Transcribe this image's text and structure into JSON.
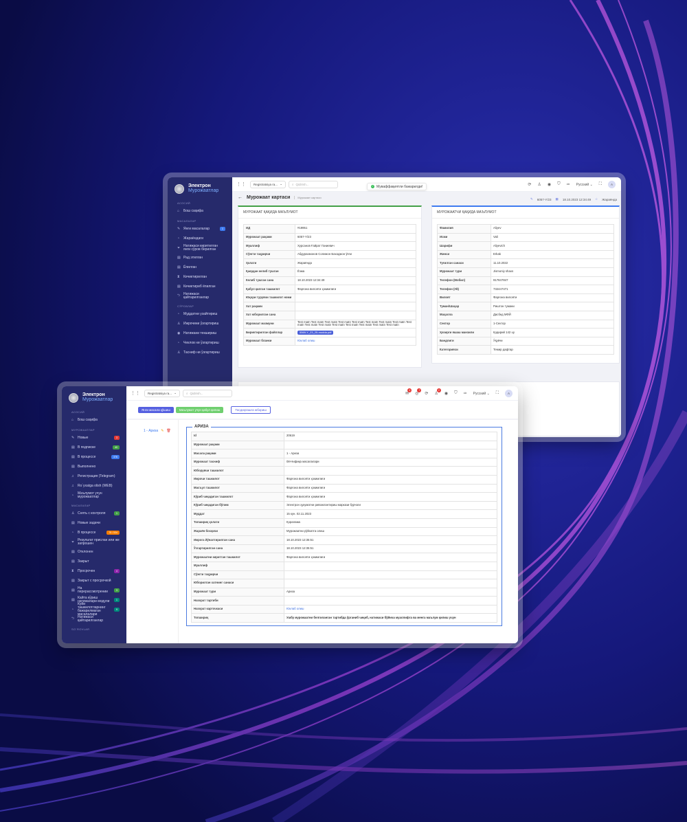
{
  "back": {
    "logo_line1": "Электрон",
    "logo_line2": "Мурожаатлар",
    "sections": [
      {
        "title": "Асосий",
        "items": [
          {
            "icon": "home-icon",
            "glyph": "⌂",
            "label": "Бош саҳифа"
          }
        ]
      },
      {
        "title": "Масалалар",
        "items": [
          {
            "icon": "edit-icon",
            "glyph": "✎",
            "label": "Янги масалалар",
            "badge": "1",
            "badge_color": "#3d7af0"
          },
          {
            "icon": "clock-icon",
            "glyph": "◔",
            "label": "Жараёндаги"
          },
          {
            "icon": "filter-icon",
            "glyph": "⏷",
            "label": "Натижаси киритилган янги сўров берилган"
          },
          {
            "icon": "doc-icon",
            "glyph": "▤",
            "label": "Рад этилган"
          },
          {
            "icon": "doc-icon",
            "glyph": "▤",
            "label": "Ёпилган"
          },
          {
            "icon": "hourglass-icon",
            "glyph": "⧗",
            "label": "Кечиктирилган"
          },
          {
            "icon": "doc-icon",
            "glyph": "▤",
            "label": "Кечиктириб ёпилган"
          },
          {
            "icon": "return-icon",
            "glyph": "⮌",
            "label": "Натижаси қайтарилганлар"
          }
        ]
      },
      {
        "title": "Сўровлар",
        "items": [
          {
            "icon": "clock-icon",
            "glyph": "◔",
            "label": "Муддатни узайтириш"
          },
          {
            "icon": "user-icon",
            "glyph": "♙",
            "label": "Ижрочини ўзгартириш"
          },
          {
            "icon": "eye-icon",
            "glyph": "◉",
            "label": "Натижани текшириш"
          },
          {
            "icon": "clock-icon",
            "glyph": "◔",
            "label": "Чеклов ни ўзгартириш"
          },
          {
            "icon": "user-icon",
            "glyph": "♙",
            "label": "Тасниф ни ўзгартириш"
          }
        ]
      }
    ],
    "topbar": {
      "select": "Registratsiya ra...",
      "search_placeholder": "Qidirish...",
      "lang": "Русский",
      "avatar": "A"
    },
    "toast": "Муваффақиятли бажарилди!",
    "page_title": "Мурожаат картаси",
    "breadcrumb": "Мурожаат картаси",
    "meta": {
      "number": "6057-Y/23",
      "date": "18.10.2023 12:34:49",
      "status": "Жараёнда"
    },
    "left_card": {
      "title": "МУРОЖААТ ҚАҚИДА МАЪЛУМОТ",
      "rows": [
        {
          "k": "ИД",
          "v": "#19951"
        },
        {
          "k": "Мурожаат рақами",
          "v": "6057-Y/23"
        },
        {
          "k": "Муаллиф",
          "v": "Хурсанов Ғайрат Ганиевич"
        },
        {
          "k": "Сўнгги таҳрирчи",
          "v": "Абдурахмонов Солижон Баходжон ўғли"
        },
        {
          "k": "Ҳолати",
          "v": "Жараёнда"
        },
        {
          "k": "Қаердан келиб тушган",
          "v": "Ёзма"
        },
        {
          "k": "Келиб тушган сана",
          "v": "18.10.2023 12:34:49"
        },
        {
          "k": "Қабул қилган ташкилот",
          "v": "Фарғона вилояти ҳокимлиги"
        },
        {
          "k": "Юқори турувчи ташкилот номи",
          "v": ""
        },
        {
          "k": "Хат рақами",
          "v": ""
        },
        {
          "k": "Хат юборилган сана",
          "v": ""
        },
        {
          "k": "Мурожаат мазмуни",
          "v": "Test matn Test matn Test matn Test matn Test matn Test matn Test matn Test matn Test matn Test matn Test matn Test matn Test matn Test matn Test matn Test matn"
        },
        {
          "k": "Бириктирилган файллар",
          "v": "5569-Y_23_25-modda.pdf",
          "file": true
        },
        {
          "k": "Мурожаат бланки",
          "v": "Юклаб олиш",
          "link": true
        }
      ]
    },
    "right_card": {
      "title": "МУРОЖААТЧИ ҚАҚИДА МАЪЛУМОТ",
      "rows": [
        {
          "k": "Фамилия",
          "v": "Aliyev"
        },
        {
          "k": "Исми",
          "v": "Vali"
        },
        {
          "k": "Шарифи",
          "v": "Aliyevich"
        },
        {
          "k": "Жинси",
          "v": "Erkak"
        },
        {
          "k": "Туғилган санаси",
          "v": "11.10.2022"
        },
        {
          "k": "Мурожаат тури",
          "v": "Jismoniy shaxs"
        },
        {
          "k": "Телефон (Мобил)",
          "v": "917847847"
        },
        {
          "k": "Телефон (Уй)",
          "v": "732447471"
        },
        {
          "k": "Вилоят",
          "v": "Фарғона вилояти"
        },
        {
          "k": "Туман/Шаҳар",
          "v": "Риштон тумани"
        },
        {
          "k": "Маҳалла",
          "v": "Дасбед МФЙ"
        },
        {
          "k": "Сектор",
          "v": "1-Сектор"
        },
        {
          "k": "Ҳозирги яшаш манзили",
          "v": "Қодирий 142 uy"
        },
        {
          "k": "Бандлиги",
          "v": "Ўқувчи"
        },
        {
          "k": "Категорияси",
          "v": "Темир дафтар"
        }
      ]
    }
  },
  "front": {
    "logo_line1": "Электрон",
    "logo_line2": "Мурожаатлар",
    "sections": [
      {
        "title": "Асосий",
        "items": [
          {
            "icon": "home-icon",
            "glyph": "⌂",
            "label": "Бош саҳифа"
          }
        ]
      },
      {
        "title": "Мурожаатлар",
        "items": [
          {
            "icon": "edit-icon",
            "glyph": "✎",
            "label": "Новые",
            "badge": "3",
            "badge_color": "#e53935"
          },
          {
            "icon": "doc-icon",
            "glyph": "▤",
            "label": "В подписке",
            "badge": "40",
            "badge_color": "#43a047"
          },
          {
            "icon": "doc-icon",
            "glyph": "▤",
            "label": "В процессе",
            "badge": "376",
            "badge_color": "#3d7af0"
          },
          {
            "icon": "doc-icon",
            "glyph": "▤",
            "label": "Выполнено"
          },
          {
            "icon": "bell-icon",
            "glyph": "♫",
            "label": "Регистрация (Telegram)"
          },
          {
            "icon": "bell-icon",
            "glyph": "♫",
            "label": "Ro`yxatga olish (WEB)"
          },
          {
            "icon": "clock-icon",
            "glyph": "◔",
            "label": "Маълумот учун мурожаатлар"
          }
        ]
      },
      {
        "title": "Масалалар",
        "items": [
          {
            "icon": "user-icon",
            "glyph": "♙",
            "label": "Снять с контроля",
            "badge": "1",
            "badge_color": "#43a047"
          },
          {
            "icon": "doc-icon",
            "glyph": "▤",
            "label": "Новые задачи"
          },
          {
            "icon": "clock-icon",
            "glyph": "◔",
            "label": "В процессе",
            "badge": "75 / 534",
            "badge_color": "#f57c00"
          },
          {
            "icon": "filter-icon",
            "glyph": "⏷",
            "label": "Результат прислан или же запрошен"
          },
          {
            "icon": "doc-icon",
            "glyph": "▤",
            "label": "Отклонен"
          },
          {
            "icon": "doc-icon",
            "glyph": "▤",
            "label": "Закрыт"
          },
          {
            "icon": "hourglass-icon",
            "glyph": "⧗",
            "label": "Просрочен",
            "badge": "4",
            "badge_color": "#8e24aa"
          },
          {
            "icon": "doc-icon",
            "glyph": "▤",
            "label": "Закрыт с просрочкой"
          },
          {
            "icon": "doc-icon",
            "glyph": "▤",
            "label": "На перерассмотрении",
            "badge": "3",
            "badge_color": "#43a047"
          },
          {
            "icon": "doc-icon",
            "glyph": "▤",
            "label": "Кайта кўриш натижалари модули",
            "badge": "1",
            "badge_color": "#00897b"
          },
          {
            "icon": "clock-icon",
            "glyph": "◔",
            "label": "Куйи ташкилотларнинг бажарилмаган масалалари",
            "badge": "9",
            "badge_color": "#00897b"
          },
          {
            "icon": "return-icon",
            "glyph": "⮌",
            "label": "Натижаси қайтарилганлар"
          }
        ]
      },
      {
        "title": "So`rovlar",
        "items": []
      }
    ],
    "topbar": {
      "select": "Registratsiya ra...",
      "search_placeholder": "Qidirish...",
      "lang": "Русский",
      "avatar": "A",
      "badges": [
        "3",
        "7",
        "2"
      ]
    },
    "buttons": {
      "new_task": "Янги масала қўшиш",
      "info_accept": "Маълумот учун қабул қилиш",
      "check": "Тасдиқлашга юбориш"
    },
    "task_item": "1 - Ариза",
    "section_title": "АРИЗА",
    "rows": [
      {
        "k": "Id",
        "v": "20619"
      },
      {
        "k": "Мурожаат рақами",
        "v": ""
      },
      {
        "k": "Масала рақами",
        "v": "1 - Ариза"
      },
      {
        "k": "Мурожаат тасниф",
        "v": "08-Нифиқа масалалари"
      },
      {
        "k": "Юборувчи ташкилот",
        "v": ""
      },
      {
        "k": "Ижрочи ташкилот",
        "v": "Фарғона вилояти ҳокимлиги"
      },
      {
        "k": "Масъул ташкилот",
        "v": "Фарғона вилояти ҳокимлиги"
      },
      {
        "k": "Кўриб чиқадиган ташкилот",
        "v": "Фарғона вилояти ҳокимлиги"
      },
      {
        "k": "Кўриб чиқадиган бўлим",
        "v": "Электрон ҳукуматни ривожлантириш маркази бурчаги"
      },
      {
        "k": "Муддат",
        "v": "15 кун. 02.11.2023"
      },
      {
        "k": "Топшириқ ҳолати",
        "v": "Қоралама"
      },
      {
        "k": "Жараён босқичи",
        "v": "Мурожаатни рўйхатга олиш"
      },
      {
        "k": "Ижрога йўналтирилган сана",
        "v": "18.10.2023 12:35:51"
      },
      {
        "k": "Ўзгартирилган сана",
        "v": "18.10.2023 12:35:51"
      },
      {
        "k": "Мурожаатни киритган ташкилот",
        "v": "Фарғона вилояти ҳокимлиги"
      },
      {
        "k": "Муаллиф",
        "v": ""
      },
      {
        "k": "Сўнгги таҳрирчи",
        "v": ""
      },
      {
        "k": "Юборилган хатнинг санаси",
        "v": ""
      },
      {
        "k": "Мурожаат тури",
        "v": "Ариза"
      },
      {
        "k": "Назорат тартиби",
        "v": ""
      },
      {
        "k": "Назорат карточкаси",
        "v": "Юклаб олиш",
        "link": true
      },
      {
        "k": "Топшириқ",
        "v": "Ушбу мурожаатни белгиланган тартибда ўрганиб чиқиб, натижаси бўйича муаллифга ва менга маълум қилиш учун",
        "bold": true
      }
    ]
  }
}
